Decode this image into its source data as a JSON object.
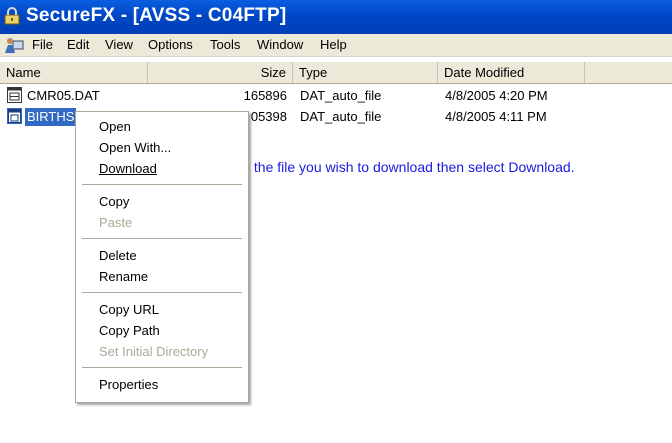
{
  "window": {
    "title": "SecureFX - [AVSS - C04FTP]",
    "title_bar_color": "#0047c6"
  },
  "menu": {
    "items": [
      "File",
      "Edit",
      "View",
      "Options",
      "Tools",
      "Window",
      "Help"
    ]
  },
  "columns": {
    "name": "Name",
    "size": "Size",
    "type": "Type",
    "date": "Date Modified"
  },
  "files": [
    {
      "name": "CMR05.DAT",
      "size": "165896",
      "type": "DAT_auto_file",
      "date": "4/8/2005 4:20 PM",
      "selected": false
    },
    {
      "name": "BIRTHS",
      "size": "05398",
      "type": "DAT_auto_file",
      "date": "4/8/2005 4:11 PM",
      "selected": true
    }
  ],
  "context_menu": {
    "open": "Open",
    "open_with": "Open With...",
    "download": "Download",
    "copy": "Copy",
    "paste": "Paste",
    "delete": "Delete",
    "rename": "Rename",
    "copy_url": "Copy URL",
    "copy_path": "Copy Path",
    "set_initial_directory": "Set Initial Directory",
    "properties": "Properties"
  },
  "annotation": {
    "text": "Right-click on the file you wish to download then select Download.",
    "color": "#1a1ae0"
  },
  "icons": {
    "app": "securefx-app-icon",
    "menu": "user-computer-icon",
    "file": "dat-file-icon"
  }
}
